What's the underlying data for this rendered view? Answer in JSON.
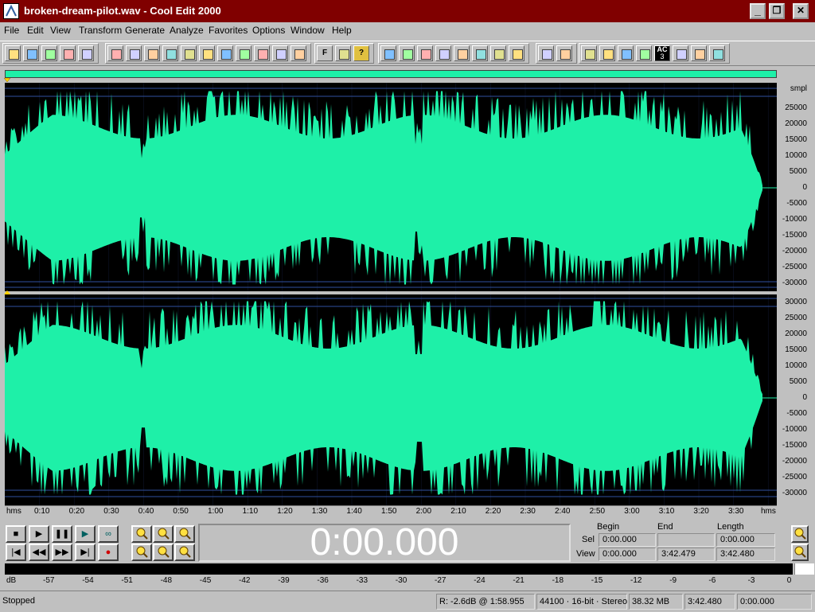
{
  "window": {
    "title": "broken-dream-pilot.wav - Cool Edit 2000",
    "controls": {
      "minimize": "_",
      "maximize": "❐",
      "close": "✕"
    }
  },
  "menu": [
    "File",
    "Edit",
    "View",
    "Transform",
    "Generate",
    "Analyze",
    "Favorites",
    "Options",
    "Window",
    "Help"
  ],
  "toolbar": {
    "groups": [
      [
        "new-file-icon",
        "open-file-icon",
        "save-icon",
        "save-as-icon",
        "close-file-icon"
      ],
      [
        "undo-icon",
        "loop-icon",
        "repeat-icon",
        "cut-region-icon",
        "copy-icon",
        "cut-icon",
        "paste-icon",
        "paste-new-icon",
        "mix-paste-icon",
        "crop-icon",
        "zoom-fit-icon"
      ],
      [
        "favorites-icon",
        "script-icon",
        "help-icon"
      ],
      [
        "amplify-icon",
        "reverse-icon",
        "silence-icon",
        "fade-icon",
        "envelope-icon",
        "add-marker-icon",
        "noise-gate-icon",
        "filter-icon"
      ],
      [
        "convert-icon",
        "grid-icon"
      ],
      [
        "analyze-icon",
        "invert-icon",
        "stretch-icon",
        "wave-icon",
        "ac3-icon",
        "eq-icon",
        "tone-icon",
        "note-icon"
      ]
    ],
    "labels": {
      "favorites": "F",
      "help": "?",
      "ac3_top": "AC",
      "ac3_bottom": "3"
    }
  },
  "waveform": {
    "color": "#1ef0a8",
    "background": "#000000",
    "units_label": "smpl",
    "amplitude_ticks": [
      "30000",
      "25000",
      "20000",
      "15000",
      "10000",
      "5000",
      "0",
      "-5000",
      "-10000",
      "-15000",
      "-20000",
      "-25000",
      "-30000"
    ],
    "time_unit_left": "hms",
    "time_unit_right": "hms",
    "time_ticks": [
      "0:10",
      "0:20",
      "0:30",
      "0:40",
      "0:50",
      "1:00",
      "1:10",
      "1:20",
      "1:30",
      "1:40",
      "1:50",
      "2:00",
      "2:10",
      "2:20",
      "2:30",
      "2:40",
      "2:50",
      "3:00",
      "3:10",
      "3:20",
      "3:30"
    ]
  },
  "transport": {
    "buttons": [
      {
        "name": "stop-button",
        "glyph": "■"
      },
      {
        "name": "play-button",
        "glyph": "▶"
      },
      {
        "name": "pause-button",
        "glyph": "❚❚"
      },
      {
        "name": "play-to-end-button",
        "glyph": "▶"
      },
      {
        "name": "loop-play-button",
        "glyph": "∞"
      },
      {
        "name": "go-to-start-button",
        "glyph": "|◀"
      },
      {
        "name": "rewind-button",
        "glyph": "◀◀"
      },
      {
        "name": "fast-forward-button",
        "glyph": "▶▶"
      },
      {
        "name": "go-to-end-button",
        "glyph": "▶|"
      },
      {
        "name": "record-button",
        "glyph": "●"
      }
    ],
    "zoom_buttons": [
      "zoom-in-icon",
      "zoom-out-icon",
      "zoom-full-icon",
      "zoom-selection-icon",
      "zoom-left-icon",
      "zoom-right-icon"
    ],
    "vertical_zoom": [
      "zoom-vertical-out-icon",
      "zoom-vertical-in-icon"
    ]
  },
  "time_display": "0:00.000",
  "selection": {
    "headers": {
      "begin": "Begin",
      "end": "End",
      "length": "Length"
    },
    "sel": {
      "label": "Sel",
      "begin": "0:00.000",
      "end": "",
      "length": "0:00.000"
    },
    "view": {
      "label": "View",
      "begin": "0:00.000",
      "end": "3:42.479",
      "length": "3:42.480"
    }
  },
  "level_meter": {
    "unit": "dB",
    "ticks": [
      "-57",
      "-54",
      "-51",
      "-48",
      "-45",
      "-42",
      "-39",
      "-36",
      "-33",
      "-30",
      "-27",
      "-24",
      "-21",
      "-18",
      "-15",
      "-12",
      "-9",
      "-6",
      "-3",
      "0"
    ]
  },
  "status": {
    "state": "Stopped",
    "cursor": "R: -2.6dB @  1:58.955",
    "format": "44100 · 16-bit · Stereo",
    "size": "38.32 MB",
    "duration": "3:42.480",
    "position": "0:00.000"
  }
}
